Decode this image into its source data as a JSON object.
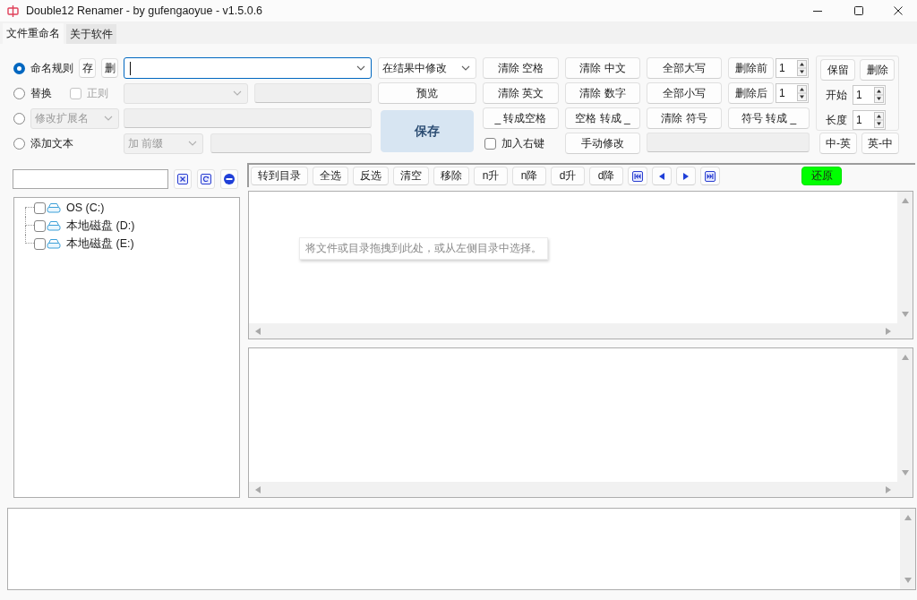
{
  "window": {
    "title": "Double12 Renamer - by gufengaoyue - v1.5.0.6"
  },
  "tabs": [
    {
      "label": "文件重命名",
      "selected": true
    },
    {
      "label": "关于软件",
      "selected": false
    }
  ],
  "modes": [
    {
      "kind": "rule",
      "label": "命名规则",
      "selected": true,
      "buttons": [
        "存",
        "删"
      ],
      "focused": true
    },
    {
      "kind": "replace",
      "label": "替换",
      "selected": false,
      "regex": {
        "label": "正则",
        "checked": false
      }
    },
    {
      "kind": "extension",
      "selected": false,
      "option": "修改扩展名"
    },
    {
      "kind": "add_text",
      "label": "添加文本",
      "selected": false,
      "option": "加 前缀"
    }
  ],
  "result_mode": "在结果中修改",
  "preview_button": "预览",
  "save_button": "保存",
  "operation_rows": [
    {
      "buttons": [
        "清除 空格",
        "清除 中文",
        "全部大写"
      ],
      "trim": {
        "label": "删除前",
        "value": "1"
      }
    },
    {
      "buttons": [
        "清除 英文",
        "清除 数字",
        "全部小写"
      ],
      "trim": {
        "label": "删除后",
        "value": "1"
      }
    },
    {
      "buttons": [
        "_ 转成空格",
        "空格 转成 _",
        "清除 符号",
        "符号 转成 _"
      ]
    }
  ],
  "context_menu": {
    "label": "加入右键",
    "checked": false
  },
  "manual_edit_button": "手动修改",
  "range": {
    "buttons": [
      "保留",
      "删除"
    ],
    "start": {
      "label": "开始",
      "value": "1"
    },
    "length": {
      "label": "长度",
      "value": "1"
    }
  },
  "translate_buttons": [
    "中-英",
    "英-中"
  ],
  "drives": [
    {
      "label": "OS (C:)",
      "checked": false
    },
    {
      "label": "本地磁盘 (D:)",
      "checked": false
    },
    {
      "label": "本地磁盘 (E:)",
      "checked": false
    }
  ],
  "toolbar": {
    "buttons": [
      "转到目录",
      "全选",
      "反选",
      "清空",
      "移除",
      "n升",
      "n降",
      "d升",
      "d降"
    ],
    "restore_button": "还原"
  },
  "file_list": {
    "hint": "将文件或目录拖拽到此处，或从左侧目录中选择。"
  }
}
